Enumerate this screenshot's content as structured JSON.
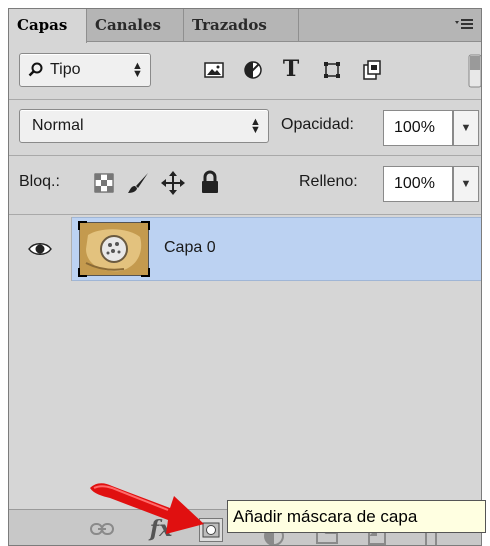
{
  "tabs": [
    {
      "label": "Capas",
      "active": true
    },
    {
      "label": "Canales",
      "active": false
    },
    {
      "label": "Trazados",
      "active": false
    }
  ],
  "panel_menu_icon": "panel-menu-icon",
  "filter": {
    "kind_label": "Tipo",
    "icons": [
      "pixel-layer-filter-icon",
      "adjustment-layer-filter-icon",
      "type-layer-filter-icon",
      "shape-layer-filter-icon",
      "smart-object-filter-icon"
    ],
    "type_glyph": "T"
  },
  "blend": {
    "mode": "Normal",
    "opacity_label": "Opacidad:",
    "opacity_value": "100%"
  },
  "lock": {
    "label": "Bloq.:",
    "fill_label": "Relleno:",
    "fill_value": "100%",
    "icons": [
      "lock-transparency-icon",
      "lock-pixels-icon",
      "lock-position-icon",
      "lock-all-icon"
    ]
  },
  "layers": [
    {
      "name": "Capa 0",
      "visible": true,
      "selected": true
    }
  ],
  "footer_icons": [
    "link-layers-icon",
    "layer-style-fx-icon",
    "add-mask-icon",
    "adjustment-layer-icon",
    "new-group-icon",
    "new-layer-icon",
    "delete-layer-icon"
  ],
  "fx_label": "fx",
  "tooltip": "Añadir máscara de capa",
  "colors": {
    "panel_bg": "#d6d6d6",
    "selection": "#bcd2f2",
    "tooltip_bg": "#ffffe1",
    "arrow": "#e01010"
  }
}
